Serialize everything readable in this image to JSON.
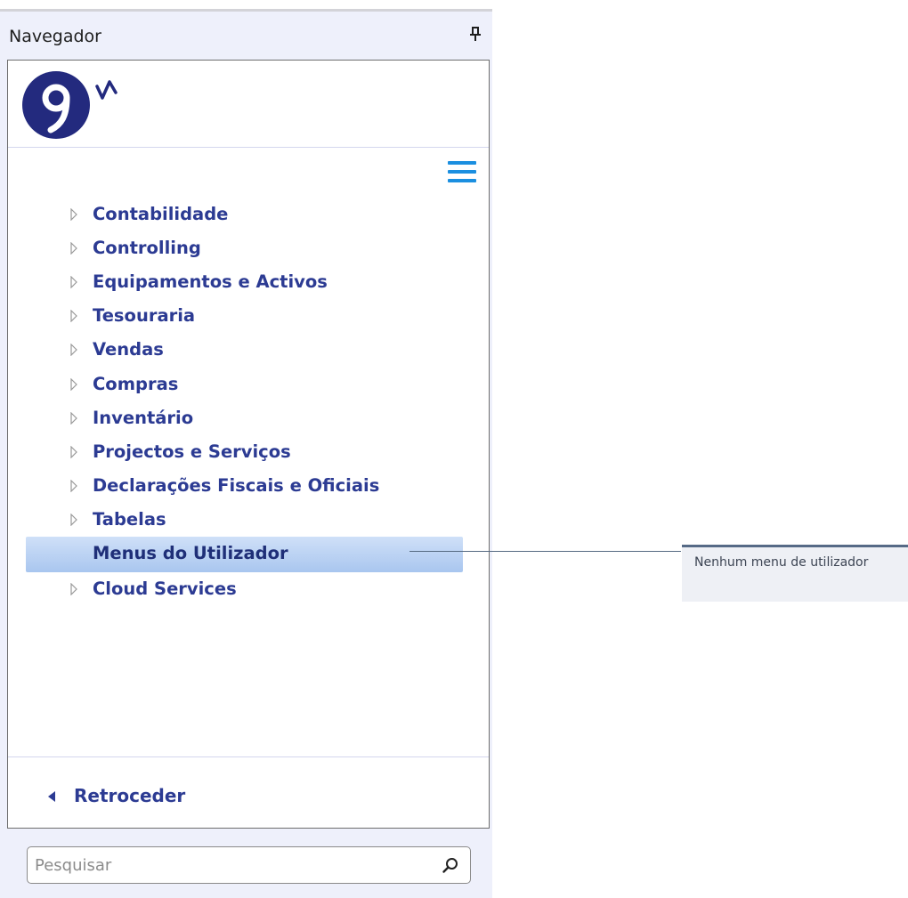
{
  "navigator": {
    "title": "Navegador",
    "pin_icon": "pin-icon",
    "logo": {
      "name": "primavera-logo-icon",
      "colors": [
        "#232a7e"
      ]
    },
    "menu_icon": "hamburger-menu-icon",
    "items": [
      {
        "label": "Contabilidade",
        "expandable": true
      },
      {
        "label": "Controlling",
        "expandable": true
      },
      {
        "label": "Equipamentos e Activos",
        "expandable": true
      },
      {
        "label": "Tesouraria",
        "expandable": true
      },
      {
        "label": "Vendas",
        "expandable": true
      },
      {
        "label": "Compras",
        "expandable": true
      },
      {
        "label": "Inventário",
        "expandable": true
      },
      {
        "label": "Projectos e Serviços",
        "expandable": true
      },
      {
        "label": "Declarações Fiscais e Oficiais",
        "expandable": true
      },
      {
        "label": "Tabelas",
        "expandable": true
      },
      {
        "label": "Menus do Utilizador",
        "expandable": false,
        "selected": true
      },
      {
        "label": "Cloud Services",
        "expandable": true
      }
    ],
    "back_label": "Retroceder",
    "search": {
      "placeholder": "Pesquisar",
      "value": ""
    }
  },
  "tooltip": {
    "text": "Nenhum menu de utilizador"
  },
  "colors": {
    "accent": "#2c3b93",
    "hamburger": "#1b8fe0",
    "selected_bg": "#b8d0f3",
    "panel_bg": "#eef0fb"
  }
}
